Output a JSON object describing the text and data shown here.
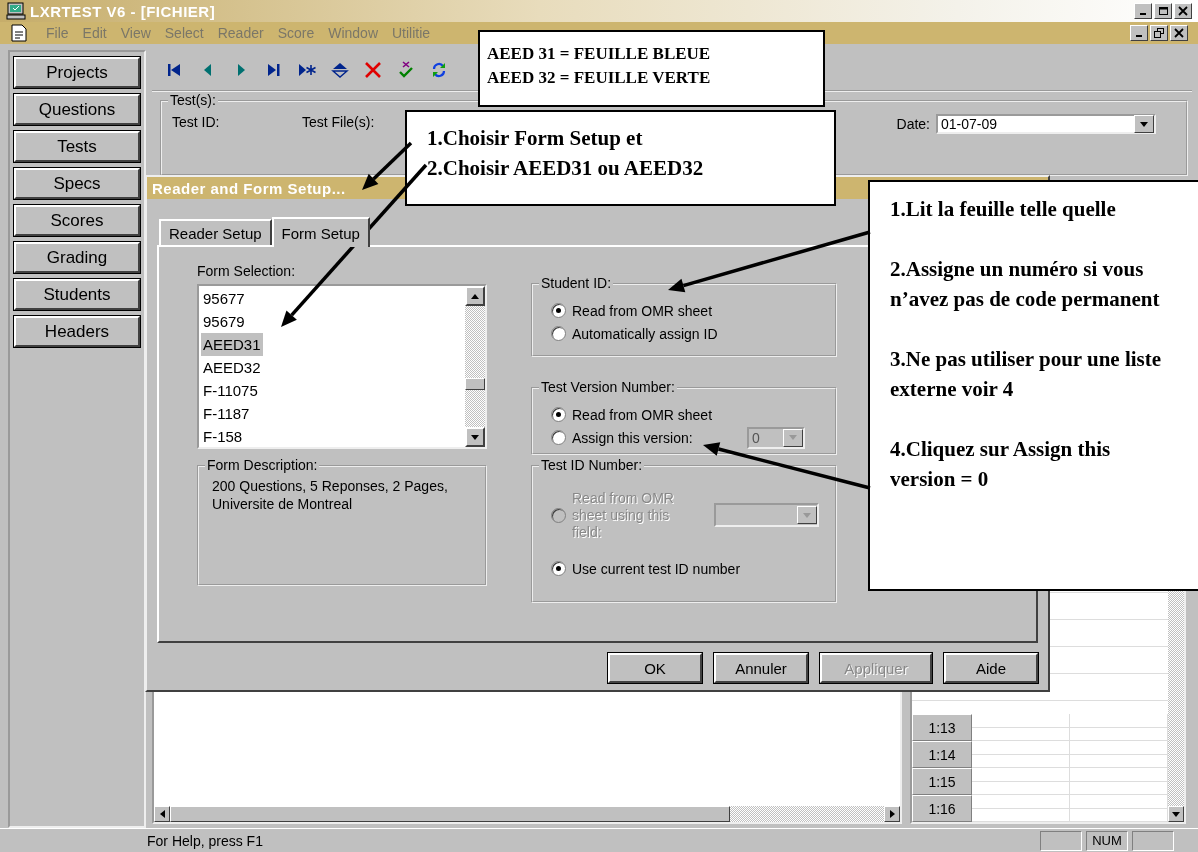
{
  "window": {
    "title": "LXRTEST V6 - [FICHIER]"
  },
  "menu": [
    "File",
    "Edit",
    "View",
    "Select",
    "Reader",
    "Score",
    "Window",
    "Utilitie"
  ],
  "sidebar": {
    "items": [
      {
        "label": "Projects"
      },
      {
        "label": "Questions"
      },
      {
        "label": "Tests"
      },
      {
        "label": "Specs"
      },
      {
        "label": "Scores"
      },
      {
        "label": "Grading"
      },
      {
        "label": "Students"
      },
      {
        "label": "Headers"
      }
    ]
  },
  "test_panel": {
    "group_label": "Test(s):",
    "test_id_label": "Test ID:",
    "test_file_label": "Test File(s):",
    "date_label": "Date:",
    "date_value": "01-07-09"
  },
  "grid": {
    "rows": [
      "1:13",
      "1:14",
      "1:15",
      "1:16"
    ]
  },
  "status_bar": {
    "help": "For Help, press F1",
    "indicator": "NUM"
  },
  "dialog": {
    "title": "Reader and Form Setup...",
    "tabs": [
      {
        "label": "Reader Setup",
        "selected": false
      },
      {
        "label": "Form Setup",
        "selected": true
      }
    ],
    "form_selection": {
      "label": "Form Selection:",
      "items": [
        {
          "label": "95677",
          "selected": false
        },
        {
          "label": "95679",
          "selected": false
        },
        {
          "label": "AEED31",
          "selected": true
        },
        {
          "label": "AEED32",
          "selected": false
        },
        {
          "label": "F-11075",
          "selected": false
        },
        {
          "label": "F-1187",
          "selected": false
        },
        {
          "label": "F-158",
          "selected": false
        }
      ]
    },
    "form_description": {
      "label": "Form Description:",
      "text": "200 Questions, 5 Reponses, 2 Pages, Universite de Montreal"
    },
    "student_id": {
      "label": "Student ID:",
      "options": [
        {
          "label": "Read from OMR sheet",
          "selected": true
        },
        {
          "label": "Automatically assign ID",
          "selected": false
        }
      ]
    },
    "test_version": {
      "label": "Test Version Number:",
      "options": [
        {
          "label": "Read from OMR sheet",
          "selected": true
        },
        {
          "label": "Assign this version:",
          "selected": false
        }
      ],
      "version_value": "0"
    },
    "test_id_number": {
      "label": "Test ID Number:",
      "options": [
        {
          "label": "Read from OMR sheet using this field:",
          "selected": false,
          "disabled": true
        },
        {
          "label": "Use current test ID number",
          "selected": true,
          "disabled": false
        }
      ]
    },
    "buttons": [
      {
        "label": "OK",
        "disabled": false
      },
      {
        "label": "Annuler",
        "disabled": false
      },
      {
        "label": "Appliquer",
        "disabled": true
      },
      {
        "label": "Aide",
        "disabled": false
      }
    ]
  },
  "annotations": [
    {
      "lines": [
        "AEED 31 = FEUILLE BLEUE",
        "AEED 32 = FEUILLE VERTE"
      ]
    },
    {
      "lines": [
        "1.Choisir Form Setup et",
        "2.Choisir AEED31 ou AEED32"
      ]
    },
    {
      "lines": [
        "1.Lit la feuille telle quelle",
        "2.Assigne un numéro si vous n’avez pas de code permanent",
        "3.Ne pas utiliser pour une liste externe voir 4",
        "4.Cliquez sur Assign this version = 0"
      ]
    }
  ]
}
